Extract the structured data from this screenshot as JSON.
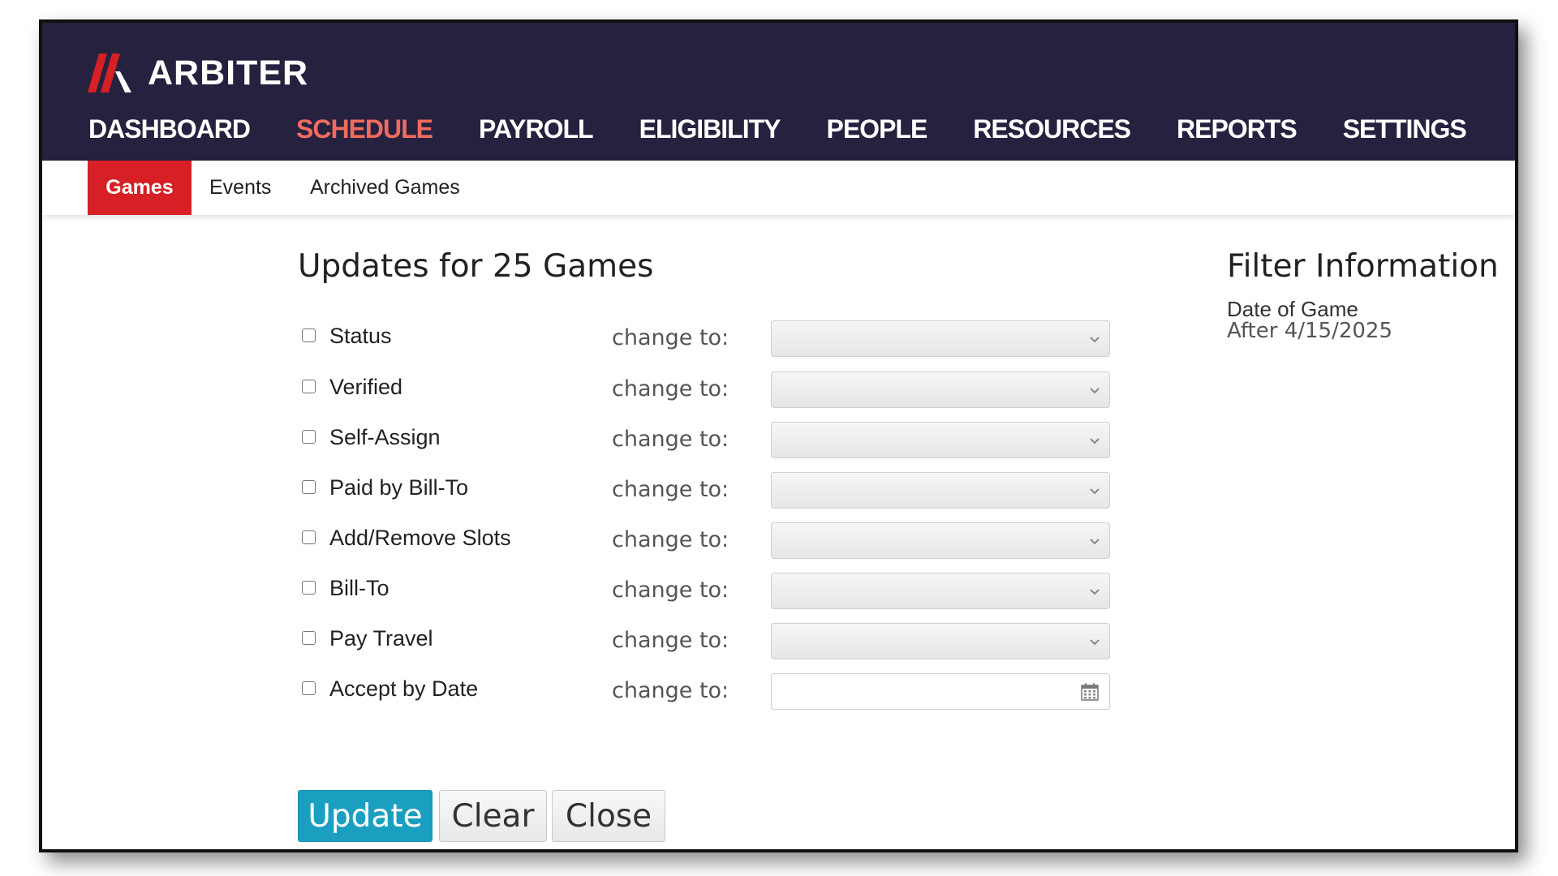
{
  "brand": {
    "name": "ARBITER",
    "logo_icon": "arbiter-slash-logo",
    "colors": {
      "navy": "#26213f",
      "red": "#d71f26",
      "active_nav": "#f06c5e",
      "primary_button": "#1a9fc0"
    }
  },
  "main_nav": {
    "items": [
      {
        "label": "DASHBOARD"
      },
      {
        "label": "SCHEDULE",
        "active": true
      },
      {
        "label": "PAYROLL"
      },
      {
        "label": "ELIGIBILITY"
      },
      {
        "label": "PEOPLE"
      },
      {
        "label": "RESOURCES"
      },
      {
        "label": "REPORTS"
      },
      {
        "label": "SETTINGS"
      }
    ]
  },
  "sub_nav": {
    "tabs": [
      {
        "label": "Games",
        "active": true
      },
      {
        "label": "Events"
      },
      {
        "label": "Archived Games"
      }
    ]
  },
  "form": {
    "title": "Updates for 25 Games",
    "change_to_label": "change to:",
    "fields": [
      {
        "label": "Status",
        "checked": false,
        "control": "select",
        "value": ""
      },
      {
        "label": "Verified",
        "checked": false,
        "control": "select",
        "value": ""
      },
      {
        "label": "Self-Assign",
        "checked": false,
        "control": "select",
        "value": ""
      },
      {
        "label": "Paid by Bill-To",
        "checked": false,
        "control": "select",
        "value": ""
      },
      {
        "label": "Add/Remove Slots",
        "checked": false,
        "control": "select",
        "value": ""
      },
      {
        "label": "Bill-To",
        "checked": false,
        "control": "select",
        "value": ""
      },
      {
        "label": "Pay Travel",
        "checked": false,
        "control": "select",
        "value": ""
      },
      {
        "label": "Accept by Date",
        "checked": false,
        "control": "date",
        "value": "",
        "icon": "calendar-icon"
      }
    ],
    "buttons": {
      "update": "Update",
      "clear": "Clear",
      "close": "Close"
    }
  },
  "filter": {
    "title": "Filter Information",
    "label": "Date of Game",
    "value": "After 4/15/2025"
  }
}
